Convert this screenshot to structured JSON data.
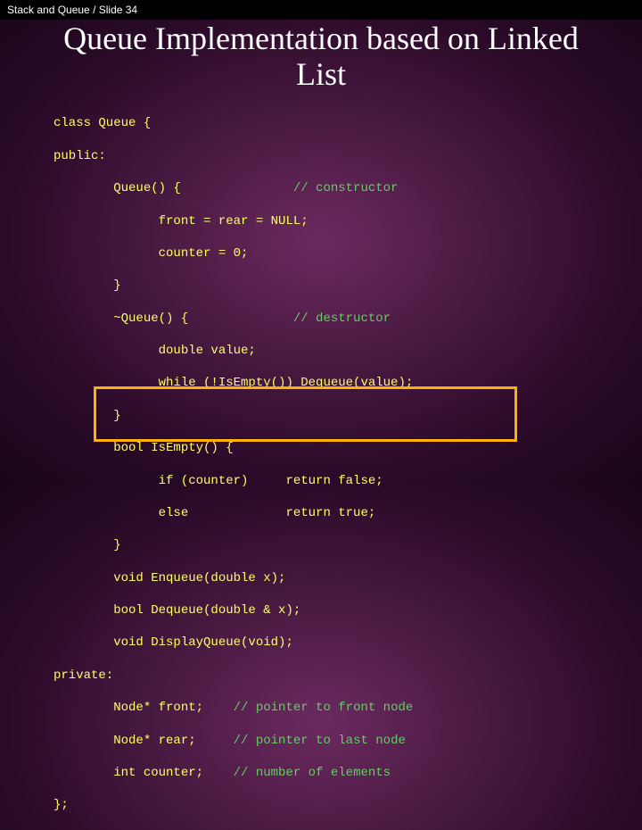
{
  "topbar": "Stack and Queue / Slide 34",
  "title": "Queue Implementation based on Linked List",
  "code": {
    "l1": "class Queue {",
    "l2": "public:",
    "l3a": "        Queue() {               ",
    "l3c": "// constructor",
    "l4": "              front = rear = NULL;",
    "l5": "              counter = 0;",
    "l6": "        }",
    "l7a": "        ~Queue() {              ",
    "l7c": "// destructor",
    "l8": "              double value;",
    "l9": "              while (!IsEmpty()) Dequeue(value);",
    "l10": "        }",
    "l11": "        bool IsEmpty() {",
    "l12": "              if (counter)     return false;",
    "l13": "              else             return true;",
    "l14": "        }",
    "l15": "        void Enqueue(double x);",
    "l16": "        bool Dequeue(double & x);",
    "l17": "        void DisplayQueue(void);",
    "l18": "private:",
    "l19a": "        Node* front;    ",
    "l19c": "// pointer to front node",
    "l20a": "        Node* rear;     ",
    "l20c": "// pointer to last node",
    "l21a": "        int counter;    ",
    "l21c": "// number of elements",
    "l22": "};"
  }
}
